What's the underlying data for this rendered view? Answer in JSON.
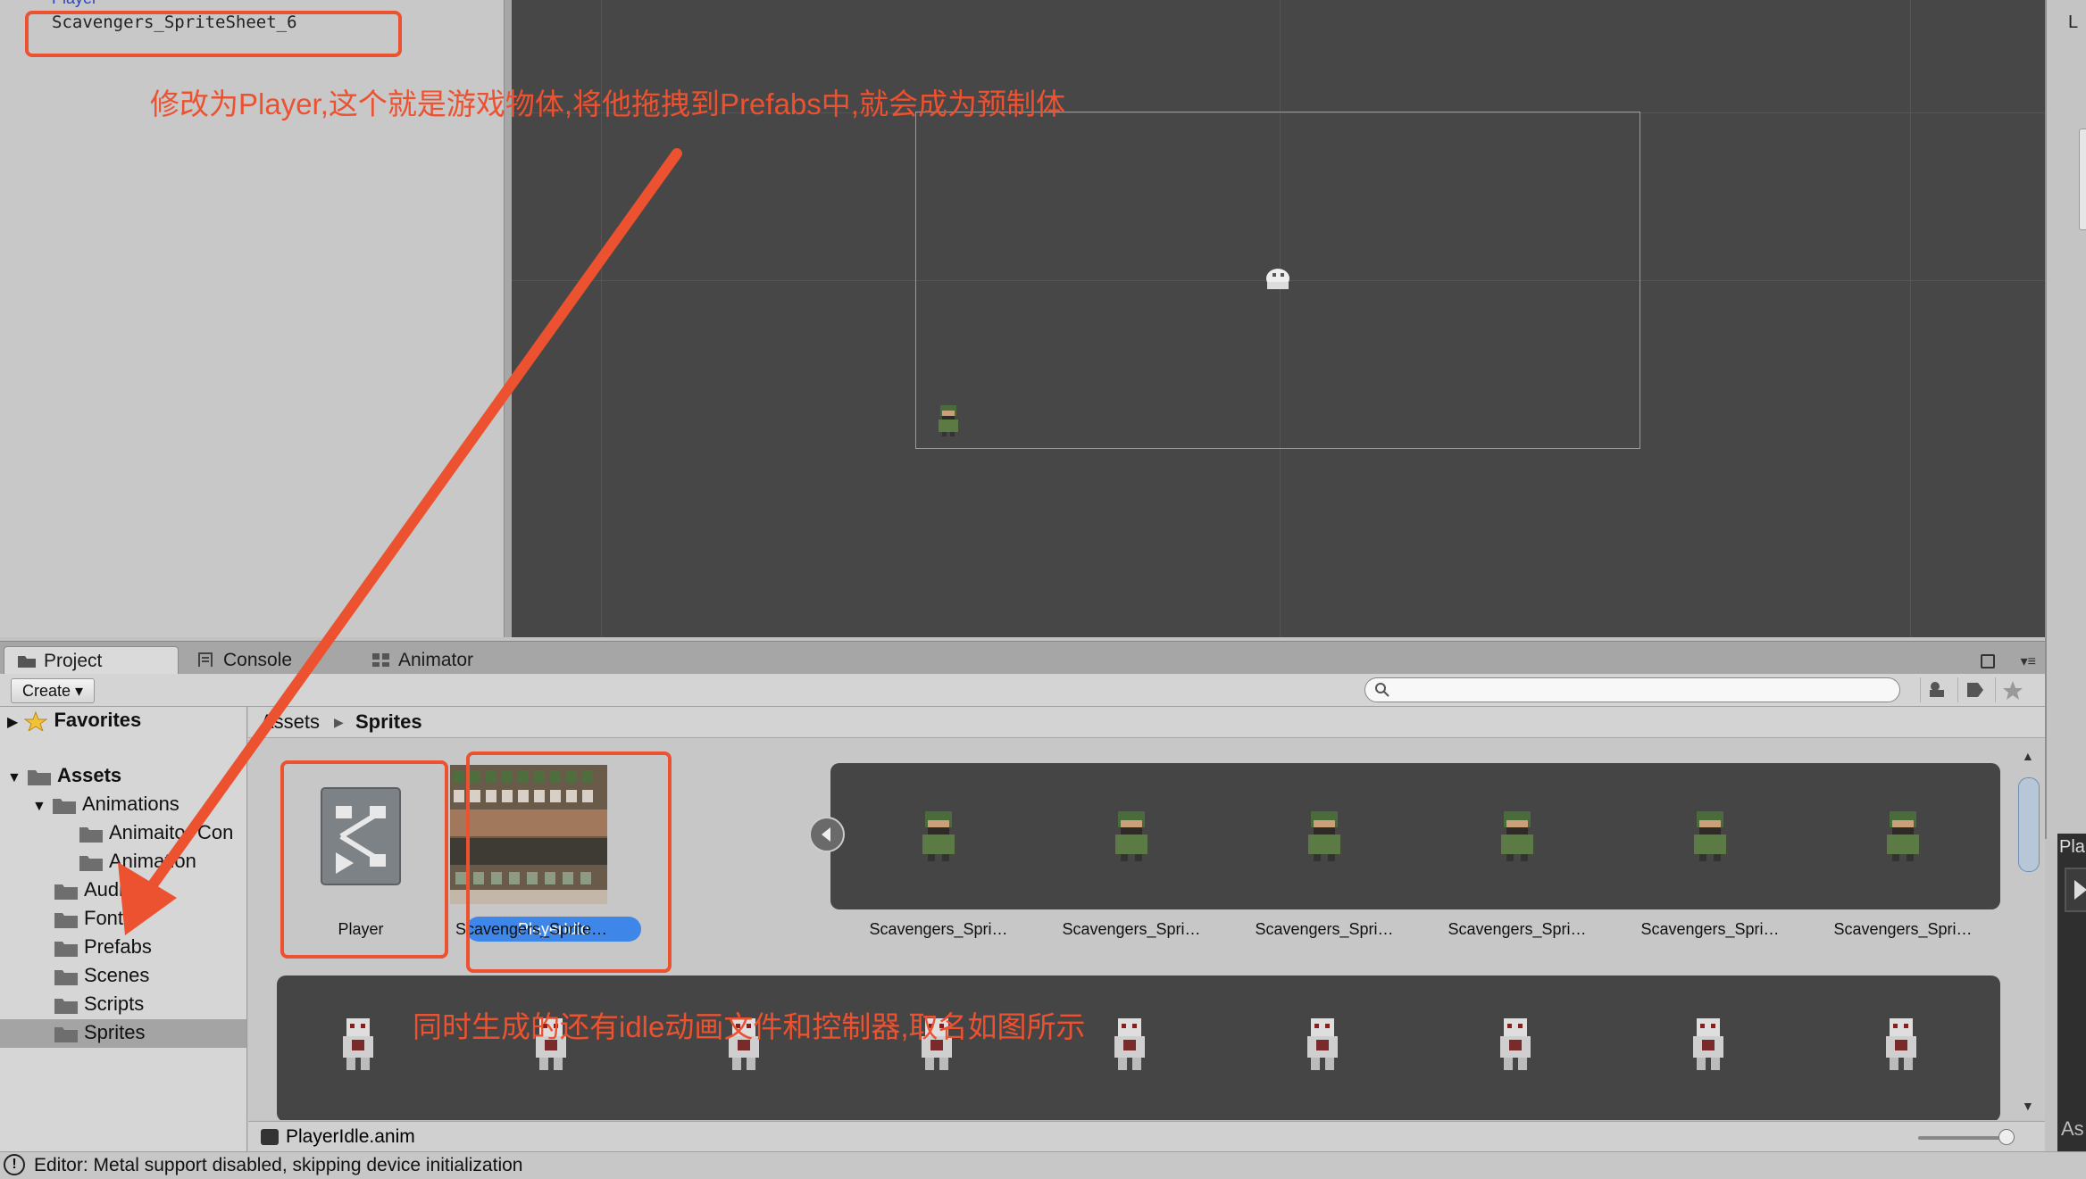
{
  "hierarchy": {
    "clipped_item": "Player",
    "item": "Scavengers_SpriteSheet_6"
  },
  "annotations": {
    "rename_hint": "修改为Player,这个就是游戏物体,将他拖拽到Prefabs中,就会成为预制体",
    "generated_hint": "同时生成的还有idle动画文件和控制器,取名如图所示"
  },
  "colors": {
    "annotation": "#ec5230",
    "selection": "#3e86e8",
    "scene_bg": "#474747"
  },
  "right_edge": {
    "top_label": "L",
    "panel_label": "Pla",
    "bottom_label": "As"
  },
  "tabs": [
    {
      "label": "Project",
      "icon": "folder-icon"
    },
    {
      "label": "Console",
      "icon": "console-icon"
    },
    {
      "label": "Animator",
      "icon": "animator-icon"
    }
  ],
  "toolbar": {
    "create_label": "Create ▾"
  },
  "tree": {
    "favorites": "Favorites",
    "assets": "Assets",
    "items": [
      {
        "label": "Animations",
        "depth": 1
      },
      {
        "label": "Animaitor Con",
        "depth": 2
      },
      {
        "label": "Animation",
        "depth": 2
      },
      {
        "label": "Audio",
        "depth": 1
      },
      {
        "label": "Fonts",
        "depth": 1
      },
      {
        "label": "Prefabs",
        "depth": 1
      },
      {
        "label": "Scenes",
        "depth": 1
      },
      {
        "label": "Scripts",
        "depth": 1
      },
      {
        "label": "Sprites",
        "depth": 1
      }
    ]
  },
  "breadcrumb": {
    "parent": "Assets",
    "current": "Sprites"
  },
  "assets": {
    "player": "Player",
    "player_idle": "PlayerIdle",
    "sheet": "Scavengers_Sprite…",
    "sprite": "Scavengers_Spri…"
  },
  "status_row": {
    "selected_file": "PlayerIdle.anim"
  },
  "footer": {
    "message": "Editor: Metal support disabled, skipping device initialization"
  }
}
